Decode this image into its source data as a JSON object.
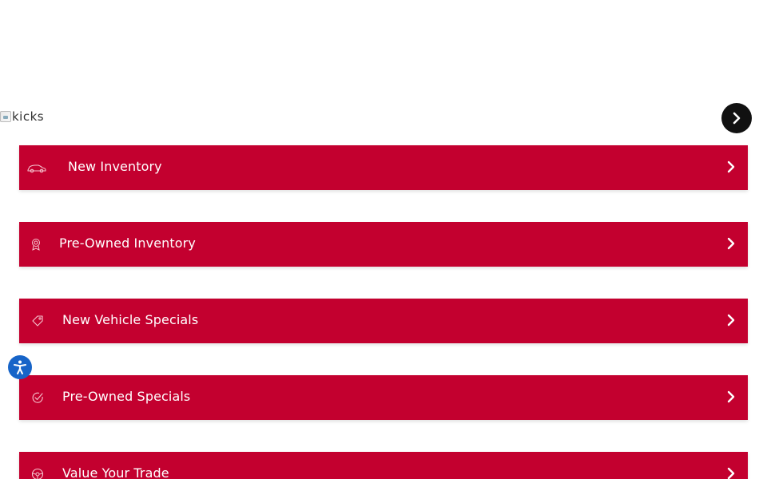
{
  "colors": {
    "brand_red": "#c3002f",
    "white": "#ffffff",
    "carousel_button": "#111111",
    "accessibility_blue": "#1764c8"
  },
  "hero_image": {
    "alt_text": "kicks"
  },
  "quick_links": [
    {
      "label": "New Inventory",
      "icon": "car-icon"
    },
    {
      "label": "Pre-Owned Inventory",
      "icon": "award-ribbon-icon"
    },
    {
      "label": "New Vehicle Specials",
      "icon": "price-tag-icon"
    },
    {
      "label": "Pre-Owned Specials",
      "icon": "check-badge-icon"
    },
    {
      "label": "Value Your Trade",
      "icon": "steering-wheel-icon"
    }
  ]
}
